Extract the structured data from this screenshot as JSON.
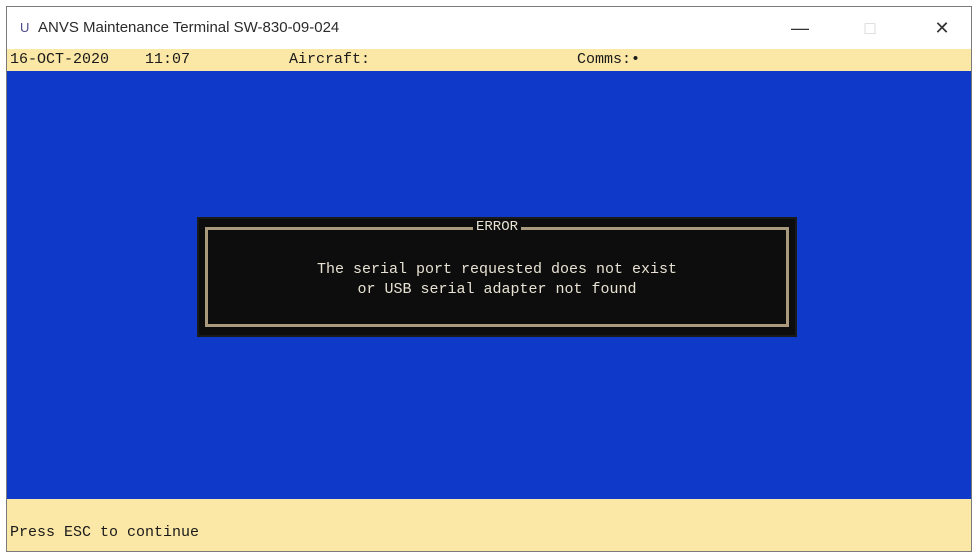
{
  "window": {
    "title": "ANVS Maintenance Terminal SW-830-09-024",
    "icon": "terminal-app-icon",
    "controls": {
      "minimize": "—",
      "maximize": "□",
      "close": "✕"
    }
  },
  "status_bar": {
    "date": "16-OCT-2020",
    "time": "11:07",
    "aircraft_label": "Aircraft:",
    "comms_label": "Comms:•"
  },
  "dialog": {
    "title": "ERROR",
    "line1": "The serial port requested does not exist",
    "line2": "or USB serial adapter not found"
  },
  "footer": {
    "prompt": "Press ESC to continue"
  },
  "colors": {
    "terminal_bg": "#0f3ac9",
    "status_bg": "#fbe7a6",
    "dialog_bg": "#0d0d0d",
    "dialog_border": "#a99a7e",
    "dialog_text": "#e8e2d4"
  }
}
